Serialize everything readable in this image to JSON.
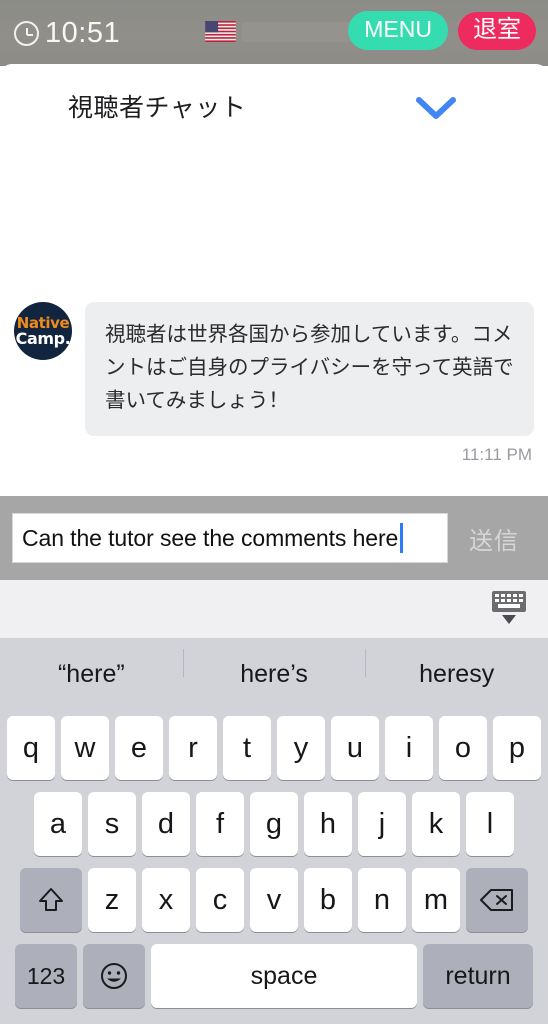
{
  "statusbar": {
    "clock_icon": "clock-icon",
    "time": "10:51",
    "flag_icon": "us-flag-icon",
    "name_redacted": "",
    "menu_label": "MENU",
    "exit_label": "退室",
    "menu_color": "#34dcb0",
    "exit_color": "#ee2b5e",
    "bar_color": "#8d8b86"
  },
  "chat": {
    "title": "視聴者チャット",
    "collapse_icon": "chevron-down-icon",
    "chevron_color": "#4285f4",
    "messages": [
      {
        "avatar_line1": "Native",
        "avatar_line2": "Camp.",
        "avatar_bg": "#12253f",
        "text": "視聴者は世界各国から参加しています。コメントはご自身のプライバシーを守って英語で書いてみましょう！",
        "time": "11:11 PM"
      }
    ]
  },
  "input": {
    "value": "Can the tutor see the comments here",
    "placeholder": "",
    "send_label": "送信",
    "caret_color": "#2b7cf6",
    "bar_color": "#a6a6a6"
  },
  "accessory": {
    "hide_keyboard_icon": "hide-keyboard-icon"
  },
  "suggestions": {
    "items": [
      "“here”",
      "here’s",
      "heresy"
    ]
  },
  "keyboard": {
    "row1": [
      "q",
      "w",
      "e",
      "r",
      "t",
      "y",
      "u",
      "i",
      "o",
      "p"
    ],
    "row2": [
      "a",
      "s",
      "d",
      "f",
      "g",
      "h",
      "j",
      "k",
      "l"
    ],
    "row3": [
      "z",
      "x",
      "c",
      "v",
      "b",
      "n",
      "m"
    ],
    "shift_icon": "shift-icon",
    "backspace_icon": "backspace-icon",
    "numbers_label": "123",
    "emoji_icon": "emoji-icon",
    "space_label": "space",
    "return_label": "return",
    "bg_color": "#d1d3d9"
  }
}
